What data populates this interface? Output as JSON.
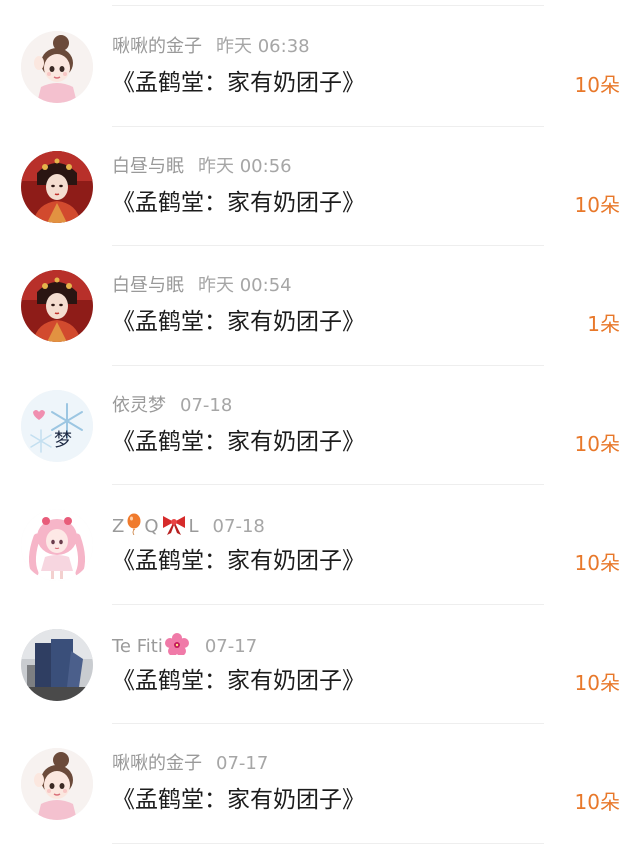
{
  "gifts": [
    {
      "user": "啾啾的金子",
      "time": "昨天 06:38",
      "title": "《孟鹤堂：家有奶团子》",
      "amount": "10朵",
      "avatar": "avatar-girl-bun-icon"
    },
    {
      "user": "白昼与眠",
      "time": "昨天 00:56",
      "title": "《孟鹤堂：家有奶团子》",
      "amount": "10朵",
      "avatar": "avatar-red-costume-icon"
    },
    {
      "user": "白昼与眠",
      "time": "昨天 00:54",
      "title": "《孟鹤堂：家有奶团子》",
      "amount": "1朵",
      "avatar": "avatar-red-costume-icon"
    },
    {
      "user": "依灵梦",
      "time": "07-18",
      "title": "《孟鹤堂：家有奶团子》",
      "amount": "10朵",
      "avatar": "avatar-snowflake-meng-icon",
      "avatar_text": "梦"
    },
    {
      "user": "Z",
      "user_middle": "Q",
      "user_end": "L",
      "time": "07-18",
      "title": "《孟鹤堂：家有奶团子》",
      "amount": "10朵",
      "avatar": "avatar-pink-hair-girl-icon",
      "emojis": [
        "balloon-emoji-icon",
        "ribbon-emoji-icon"
      ]
    },
    {
      "user": "Te Fiti",
      "time": "07-17",
      "title": "《孟鹤堂：家有奶团子》",
      "amount": "10朵",
      "avatar": "avatar-clothes-photo-icon",
      "emojis": [
        "hibiscus-emoji-icon"
      ]
    },
    {
      "user": "啾啾的金子",
      "time": "07-17",
      "title": "《孟鹤堂：家有奶团子》",
      "amount": "10朵",
      "avatar": "avatar-girl-bun-icon"
    }
  ],
  "colors": {
    "amount": "#e8782a",
    "username": "#9a9a9a",
    "title": "#1c1c1c",
    "divider": "#eeeeee"
  }
}
